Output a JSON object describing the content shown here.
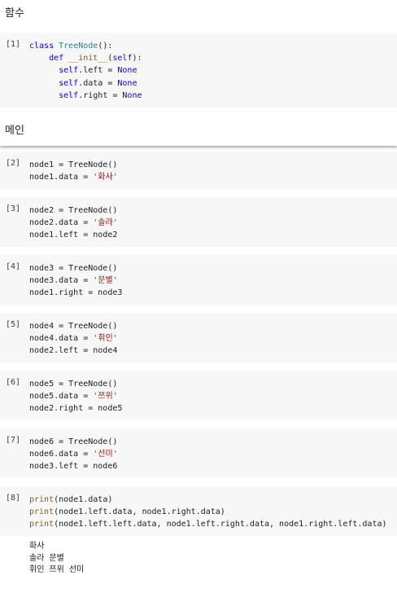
{
  "sections": {
    "functions_heading": "함수",
    "main_heading": "메인"
  },
  "cells": [
    {
      "prompt": "[1]",
      "lines": [
        [
          "class",
          " ",
          "TreeNode",
          "():"
        ],
        [
          "    ",
          "def",
          " ",
          "__init__",
          "(",
          "self",
          "):"
        ],
        [
          "      ",
          "self",
          ".left = ",
          "None"
        ],
        [
          "      ",
          "self",
          ".data = ",
          "None"
        ],
        [
          "      ",
          "self",
          ".right = ",
          "None"
        ]
      ]
    },
    {
      "prompt": "[2]",
      "line1": "node1 = TreeNode()",
      "line2a": "node1.data = ",
      "line2b": "'화사'"
    },
    {
      "prompt": "[3]",
      "line1": "node2 = TreeNode()",
      "line2a": "node2.data = ",
      "line2b": "'솔라'",
      "line3": "node1.left = node2"
    },
    {
      "prompt": "[4]",
      "line1": "node3 = TreeNode()",
      "line2a": "node3.data = ",
      "line2b": "'문별'",
      "line3": "node1.right = node3"
    },
    {
      "prompt": "[5]",
      "line1": "node4 = TreeNode()",
      "line2a": "node4.data = ",
      "line2b": "'휘인'",
      "line3": "node2.left = node4"
    },
    {
      "prompt": "[6]",
      "line1": "node5 = TreeNode()",
      "line2a": "node5.data = ",
      "line2b": "'쯔위'",
      "line3": "node2.right = node5"
    },
    {
      "prompt": "[7]",
      "line1": "node6 = TreeNode()",
      "line2a": "node6.data = ",
      "line2b": "'선미'",
      "line3": "node3.left = node6"
    },
    {
      "prompt": "[8]",
      "print_kw": "print",
      "args1": "(node1.data)",
      "args2": "(node1.left.data, node1.right.data)",
      "args3": "(node1.left.left.data, node1.left.right.data, node1.right.left.data)"
    }
  ],
  "output": [
    "화사",
    "솔라 문별",
    "휘인 쯔위 선미"
  ]
}
